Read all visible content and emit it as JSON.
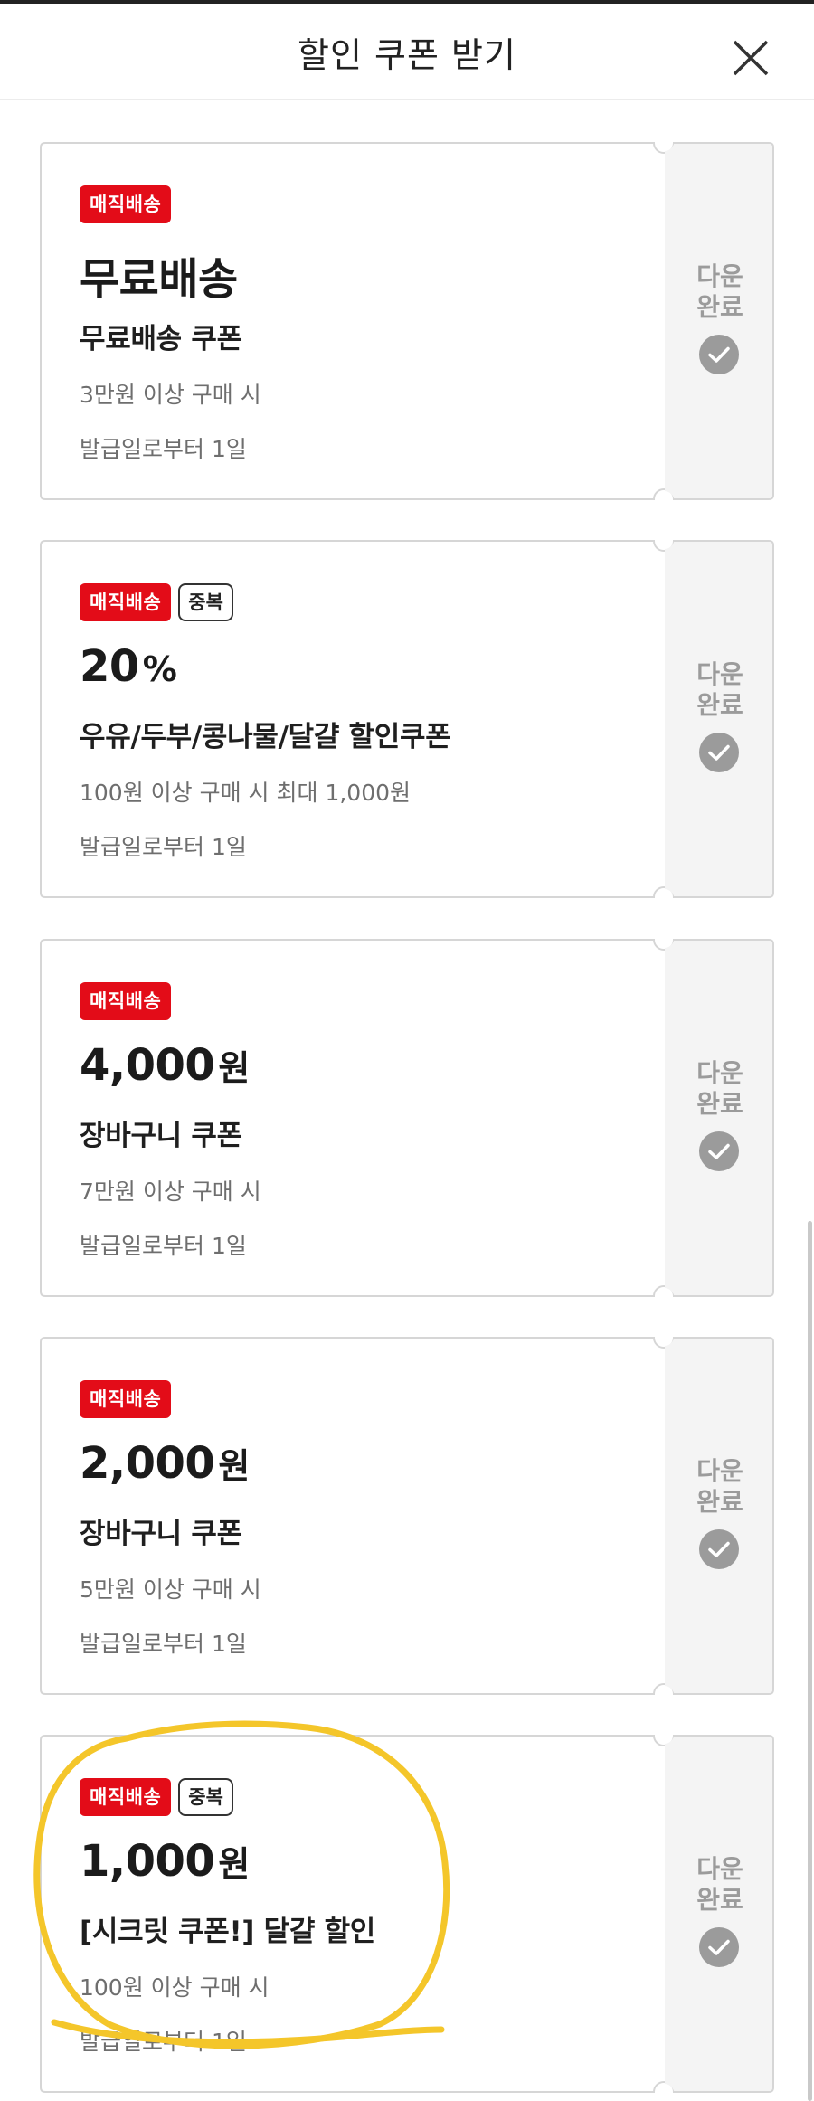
{
  "header": {
    "title": "할인 쿠폰 받기",
    "close_icon": "close-icon"
  },
  "colors": {
    "badge_red": "#e30c18",
    "side_panel": "#f4f4f4",
    "done_text": "#9b9b9b",
    "highlight": "#f4c62a"
  },
  "coupons": [
    {
      "badges": [
        "매직배송"
      ],
      "amount": "무료배송",
      "unit": "",
      "name": "무료배송 쿠폰",
      "condition": "3만원 이상 구매 시",
      "validity": "발급일로부터 1일",
      "status": "다운\n완료"
    },
    {
      "badges": [
        "매직배송",
        "중복"
      ],
      "amount": "20",
      "unit": "%",
      "name": "우유/두부/콩나물/달걀 할인쿠폰",
      "condition": "100원 이상 구매 시 최대 1,000원",
      "validity": "발급일로부터 1일",
      "status": "다운\n완료"
    },
    {
      "badges": [
        "매직배송"
      ],
      "amount": "4,000",
      "unit": "원",
      "name": "장바구니 쿠폰",
      "condition": "7만원 이상 구매 시",
      "validity": "발급일로부터 1일",
      "status": "다운\n완료"
    },
    {
      "badges": [
        "매직배송"
      ],
      "amount": "2,000",
      "unit": "원",
      "name": "장바구니 쿠폰",
      "condition": "5만원 이상 구매 시",
      "validity": "발급일로부터 1일",
      "status": "다운\n완료"
    },
    {
      "badges": [
        "매직배송",
        "중복"
      ],
      "amount": "1,000",
      "unit": "원",
      "name": "[시크릿 쿠폰!] 달걀 할인",
      "condition": "100원 이상 구매 시",
      "validity": "발급일로부터 1일",
      "status": "다운\n완료"
    }
  ]
}
